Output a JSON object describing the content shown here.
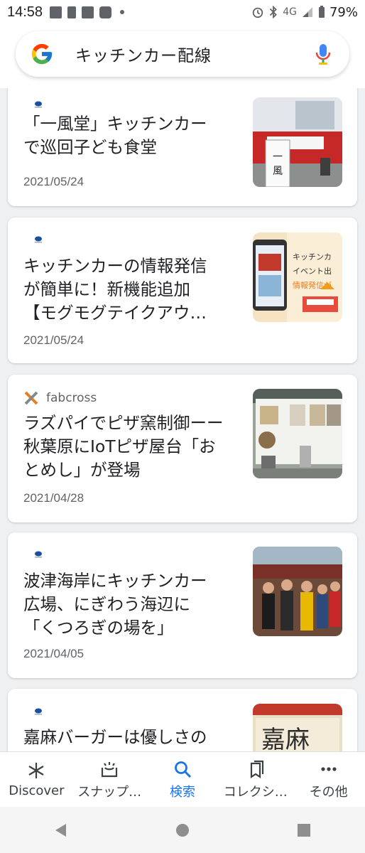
{
  "status": {
    "time": "14:58",
    "network": "4G",
    "battery": "79%"
  },
  "search": {
    "query": "キッチンカー配線"
  },
  "cards": [
    {
      "source": "",
      "title_lines": [
        "「一風堂」キッチンカー",
        "で巡回子ども食堂"
      ],
      "date": "2021/05/24"
    },
    {
      "source": "",
      "title_lines": [
        "キッチンカーの情報発信",
        "が簡単に！新機能追加",
        "【モグモグテイクアウ…"
      ],
      "date": "2021/05/24",
      "thumb_text": [
        "キッチンカ",
        "イベント出",
        "情報発信が"
      ]
    },
    {
      "source": "fabcross",
      "title_lines": [
        "ラズパイでピザ窯制御ーー",
        "秋葉原にIoTピザ屋台「お",
        "とめし」が登場"
      ],
      "date": "2021/04/28"
    },
    {
      "source": "",
      "title_lines": [
        "波津海岸にキッチンカー",
        "広場、にぎわう海辺に",
        "「くつろぎの場を」"
      ],
      "date": "2021/04/05"
    },
    {
      "source": "",
      "title_lines": [
        "嘉麻バーガーは優しさの"
      ],
      "date": "",
      "thumb_text": [
        "嘉麻"
      ]
    }
  ],
  "nav": {
    "discover": "Discover",
    "snapshot": "スナップ…",
    "search": "検索",
    "collections": "コレクシ…",
    "more": "その他"
  },
  "colors": {
    "accent": "#1a73e8"
  }
}
